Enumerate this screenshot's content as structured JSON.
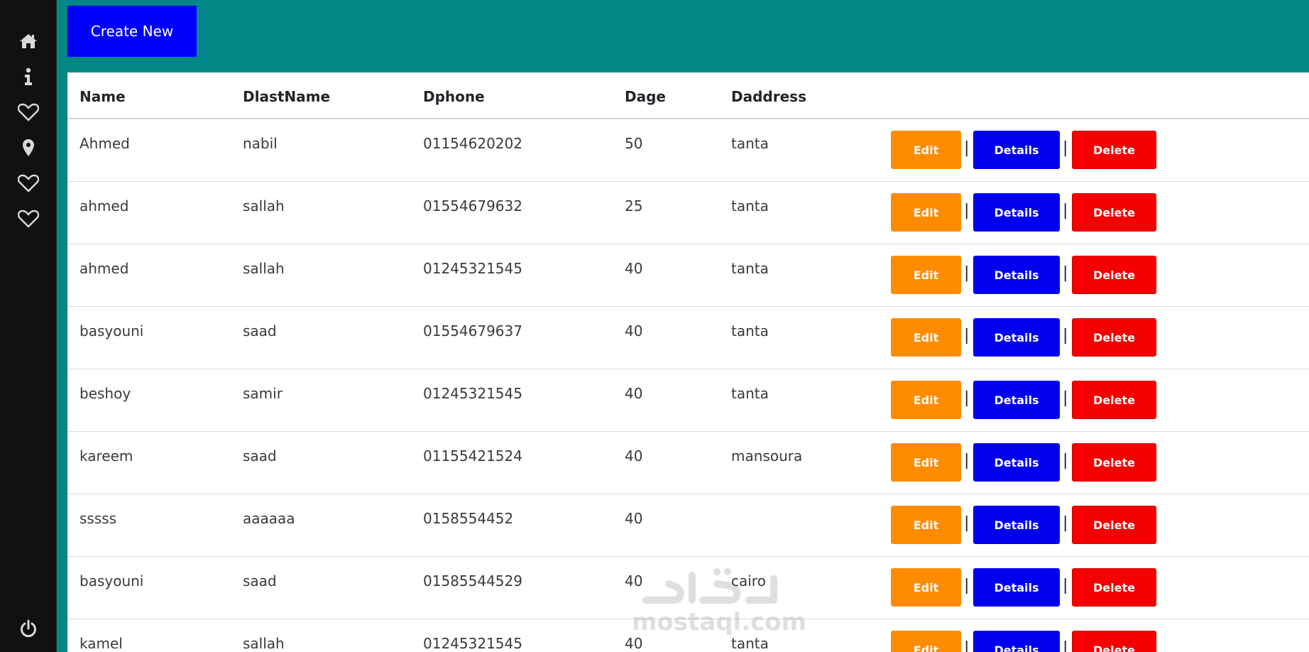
{
  "sidebar": {
    "icons": [
      "home-icon",
      "info-icon",
      "heart-icon",
      "map-pin-icon",
      "heart-icon",
      "heart-icon"
    ],
    "bottom_icon": "power-icon"
  },
  "toolbar": {
    "create_label": "Create New"
  },
  "table": {
    "headers": [
      "Name",
      "DlastName",
      "Dphone",
      "Dage",
      "Daddress"
    ],
    "rows": [
      {
        "name": "Ahmed",
        "lastname": "nabil",
        "phone": "01154620202",
        "age": "50",
        "address": "tanta"
      },
      {
        "name": "ahmed",
        "lastname": "sallah",
        "phone": "01554679632",
        "age": "25",
        "address": "tanta"
      },
      {
        "name": "ahmed",
        "lastname": "sallah",
        "phone": "01245321545",
        "age": "40",
        "address": "tanta"
      },
      {
        "name": "basyouni",
        "lastname": "saad",
        "phone": "01554679637",
        "age": "40",
        "address": "tanta"
      },
      {
        "name": "beshoy",
        "lastname": "samir",
        "phone": "01245321545",
        "age": "40",
        "address": "tanta"
      },
      {
        "name": "kareem",
        "lastname": "saad",
        "phone": "01155421524",
        "age": "40",
        "address": "mansoura"
      },
      {
        "name": "sssss",
        "lastname": "aaaaaa",
        "phone": "0158554452",
        "age": "40",
        "address": ""
      },
      {
        "name": "basyouni",
        "lastname": "saad",
        "phone": "01585544529",
        "age": "40",
        "address": "cairo"
      },
      {
        "name": "kamel",
        "lastname": "sallah",
        "phone": "01245321545",
        "age": "40",
        "address": "tanta"
      }
    ],
    "actions": {
      "edit": "Edit",
      "details": "Details",
      "delete": "Delete",
      "separator": "|"
    }
  },
  "watermark": {
    "text": "mostaql.com"
  },
  "colors": {
    "sidebar": "#111111",
    "header_bg": "#038786",
    "create_button": "#0000ff",
    "edit_button": "#ff8b00",
    "details_button": "#0000ee",
    "delete_button": "#f40000"
  }
}
